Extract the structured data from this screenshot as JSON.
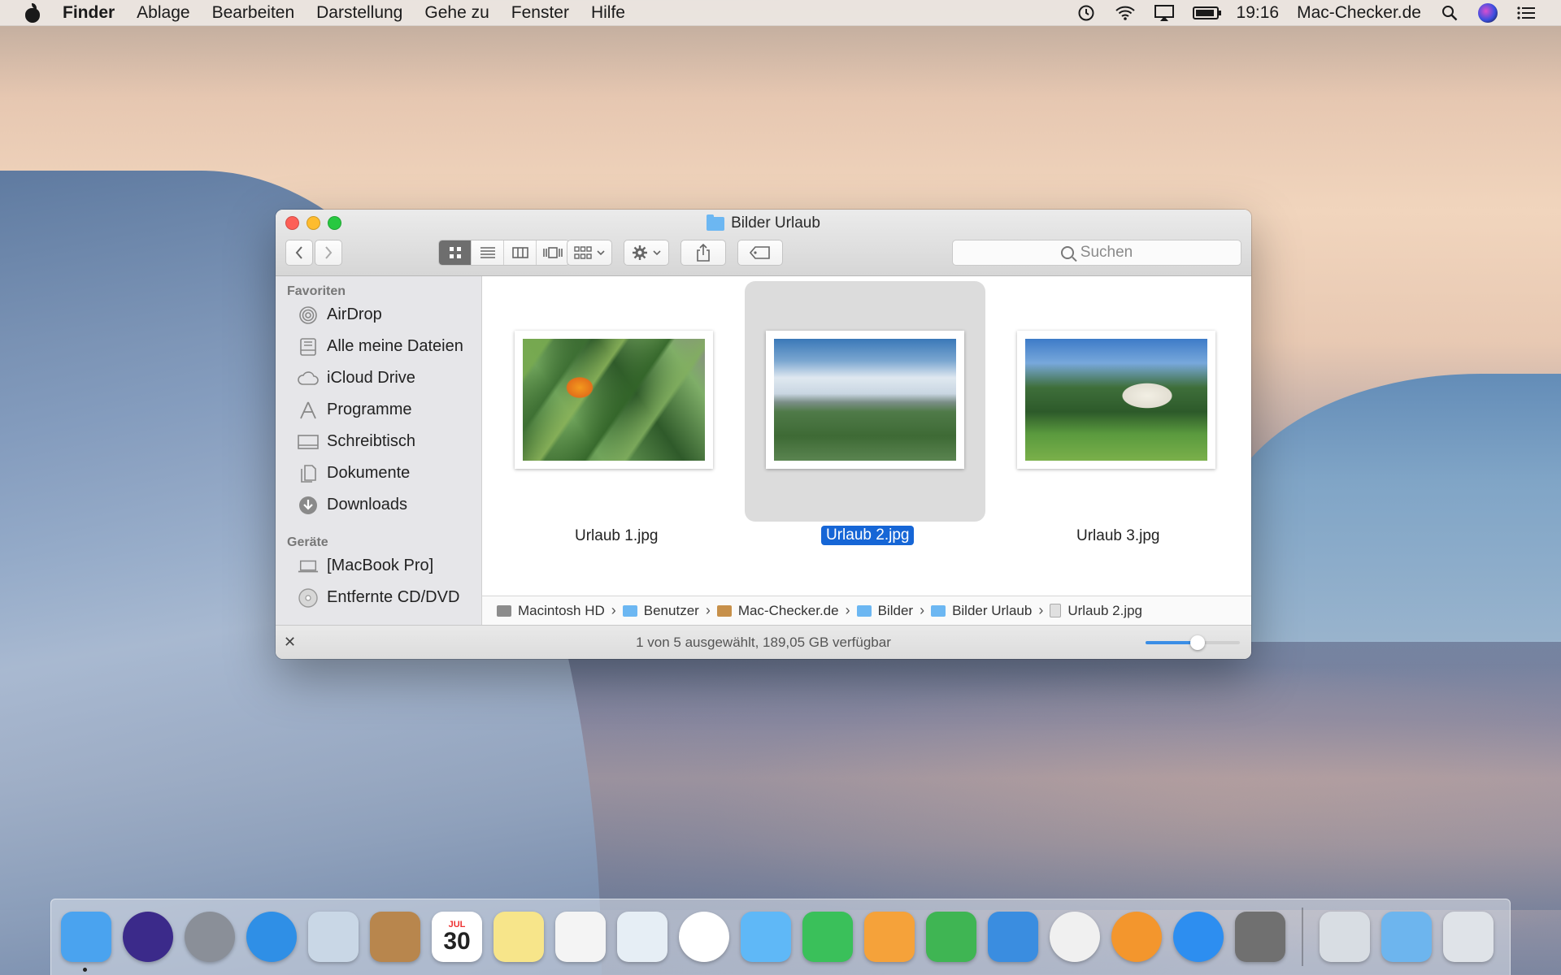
{
  "menubar": {
    "app": "Finder",
    "items": [
      "Ablage",
      "Bearbeiten",
      "Darstellung",
      "Gehe zu",
      "Fenster",
      "Hilfe"
    ],
    "time": "19:16",
    "user": "Mac-Checker.de"
  },
  "window": {
    "title": "Bilder Urlaub",
    "search_placeholder": "Suchen",
    "sidebar": {
      "favorites_header": "Favoriten",
      "favorites": [
        {
          "label": "AirDrop",
          "icon": "airdrop-icon"
        },
        {
          "label": "Alle meine Dateien",
          "icon": "all-files-icon"
        },
        {
          "label": "iCloud Drive",
          "icon": "cloud-icon"
        },
        {
          "label": "Programme",
          "icon": "applications-icon"
        },
        {
          "label": "Schreibtisch",
          "icon": "desktop-icon"
        },
        {
          "label": "Dokumente",
          "icon": "documents-icon"
        },
        {
          "label": "Downloads",
          "icon": "downloads-icon"
        }
      ],
      "devices_header": "Geräte",
      "devices": [
        {
          "label": "[MacBook Pro]",
          "icon": "laptop-icon"
        },
        {
          "label": "Entfernte CD/DVD",
          "icon": "disc-icon"
        }
      ]
    },
    "files": [
      {
        "name": "Urlaub 1.jpg",
        "selected": false
      },
      {
        "name": "Urlaub 2.jpg",
        "selected": true
      },
      {
        "name": "Urlaub 3.jpg",
        "selected": false
      }
    ],
    "path": [
      "Macintosh HD",
      "Benutzer",
      "Mac-Checker.de",
      "Bilder",
      "Bilder Urlaub",
      "Urlaub 2.jpg"
    ],
    "status": "1 von 5 ausgewählt, 189,05 GB verfügbar",
    "icon_size_slider": 0.55
  },
  "dock": {
    "apps": [
      {
        "name": "finder-icon",
        "color": "#4aa3ef"
      },
      {
        "name": "siri-icon",
        "color": "#3b2a8a"
      },
      {
        "name": "launchpad-icon",
        "color": "#8a8f98"
      },
      {
        "name": "safari-icon",
        "color": "#2f8fe6"
      },
      {
        "name": "mail-icon",
        "color": "#c9d7e6"
      },
      {
        "name": "contacts-icon",
        "color": "#b8864d"
      },
      {
        "name": "calendar-icon",
        "color": "#ffffff",
        "text": "30",
        "month": "JUL"
      },
      {
        "name": "notes-icon",
        "color": "#f7e58a"
      },
      {
        "name": "reminders-icon",
        "color": "#f4f4f4"
      },
      {
        "name": "preview-icon",
        "color": "#e6eef5"
      },
      {
        "name": "photos-icon",
        "color": "#ffffff"
      },
      {
        "name": "messages-icon",
        "color": "#5fb8f7"
      },
      {
        "name": "facetime-icon",
        "color": "#3ac05a"
      },
      {
        "name": "pages-icon",
        "color": "#f5a23a"
      },
      {
        "name": "numbers-icon",
        "color": "#3fb553"
      },
      {
        "name": "keynote-icon",
        "color": "#3a8de0"
      },
      {
        "name": "itunes-icon",
        "color": "#f0f0f0"
      },
      {
        "name": "ibooks-icon",
        "color": "#f3962d"
      },
      {
        "name": "app-store-icon",
        "color": "#2d8ef0"
      },
      {
        "name": "system-preferences-icon",
        "color": "#707070"
      }
    ],
    "stacks": [
      {
        "name": "documents-stack-icon",
        "color": "#d8dde3"
      },
      {
        "name": "downloads-stack-icon",
        "color": "#6db5ee"
      },
      {
        "name": "trash-icon",
        "color": "#dfe3e8"
      }
    ]
  }
}
